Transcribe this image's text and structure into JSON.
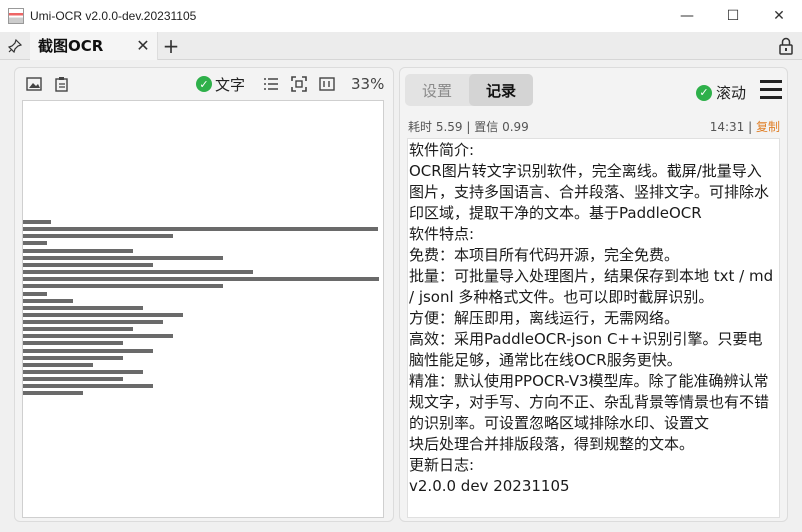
{
  "window": {
    "title": "Umi-OCR v2.0.0-dev.20231105",
    "minimize": "—",
    "maximize": "☐",
    "close": "✕"
  },
  "tabs": {
    "pin_icon": "pin-icon",
    "items": [
      {
        "label": "截图OCR",
        "close": "✕"
      }
    ],
    "add": "+"
  },
  "left_toolbar": {
    "text_toggle_label": "文字",
    "zoom": "33%"
  },
  "right_panel": {
    "tabs": [
      "设置",
      "记录"
    ],
    "active_tab": "记录",
    "scroll_label": "滚动",
    "meta": {
      "elapsed": "耗时 5.59",
      "confidence": "置信 0.99",
      "time": "14:31",
      "separator": "|",
      "copy": "复制"
    },
    "lines": [
      "软件简介:",
      "OCR图片转文字识别软件，完全离线。截屏/批量导入图片，支持多国语言、合并段落、竖排文字。可排除水印区域，提取干净的文本。基于PaddleOCR",
      "软件特点:",
      "免费：本项目所有代码开源，完全免费。",
      "批量：可批量导入处理图片，结果保存到本地 txt / md  / jsonl 多种格式文件。也可以即时截屏识别。",
      "方便：解压即用，离线运行，无需网络。",
      "高效：采用PaddleOCR-json C++识别引擎。只要电脑性能足够，通常比在线OCR服务更快。",
      "精准：默认使用PPOCR-V3模型库。除了能准确辨认常规文字，对手写、方向不正、杂乱背景等情景也有不错的识别率。可设置忽略区域排除水印、设置文",
      "块后处理合并排版段落，得到规整的文本。",
      "更新日志:",
      "v2.0.0 dev 20231105"
    ]
  },
  "colors": {
    "check_green": "#2eb04a",
    "copy_orange": "#e0802a"
  }
}
